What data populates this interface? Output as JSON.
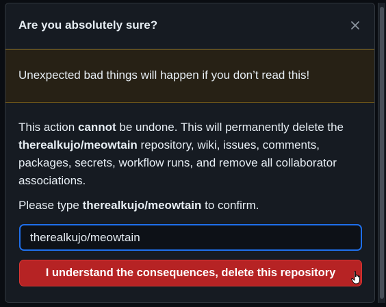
{
  "dialog": {
    "title": "Are you absolutely sure?",
    "close_icon": "close-icon",
    "warning": "Unexpected bad things will happen if you don’t read this!",
    "body": {
      "part1": "This action ",
      "part2_bold": "cannot",
      "part3": " be undone. This will permanently delete the ",
      "part4_bold": "therealkujo/meowtain",
      "part5": " repository, wiki, issues, comments, packages, secrets, workflow runs, and remove all collaborator associations."
    },
    "confirm": {
      "prefix": "Please type ",
      "repo_bold": "therealkujo/meowtain",
      "suffix": " to confirm."
    },
    "input_value": "therealkujo/meowtain",
    "delete_button_label": "I understand the consequences, delete this repository"
  },
  "colors": {
    "danger": "#b62324",
    "focus": "#1f6feb",
    "warning_bg": "#272115"
  }
}
